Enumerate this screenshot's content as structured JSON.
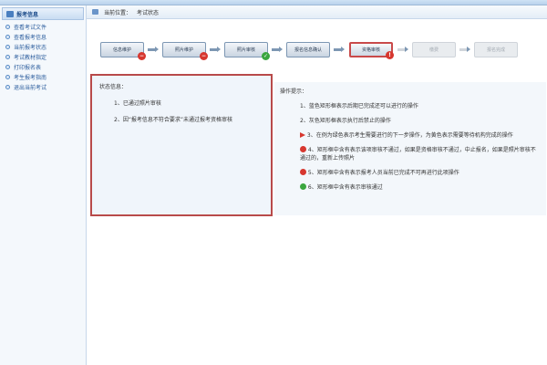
{
  "sidebar": {
    "header": "报考信息",
    "items": [
      {
        "label": "查看考试文件"
      },
      {
        "label": "查看报考信息"
      },
      {
        "label": "当前报考状态"
      },
      {
        "label": "考试教材指定"
      },
      {
        "label": "打印报名表"
      },
      {
        "label": "考生报考指南"
      },
      {
        "label": "退出当前考试"
      }
    ]
  },
  "breadcrumb": {
    "prefix": "当前位置：",
    "current": "考试状态"
  },
  "flow": {
    "steps": [
      {
        "label": "信息维护",
        "status": "error"
      },
      {
        "label": "照片维护",
        "status": "error"
      },
      {
        "label": "照片审核",
        "status": "ok"
      },
      {
        "label": "报名信息确认",
        "status": "none"
      },
      {
        "label": "资格审核",
        "status": "error"
      },
      {
        "label": "缴费",
        "status": "disabled"
      },
      {
        "label": "报名完成",
        "status": "disabled"
      }
    ]
  },
  "status": {
    "title": "状态信息：",
    "rows": [
      "1、已通过照片审核",
      "2、因“报考信息不符合要求”未通过报考资格审核"
    ]
  },
  "tips": {
    "title": "操作提示：",
    "items": [
      "1、蓝色矩形框表示后期已完成还可以进行的操作",
      "2、灰色矩形框表示执行后禁止的操作",
      "3、在例为绿色表示考生需要进行的下一步操作，为黄色表示需要等待机构完成的操作",
      "4、矩形框中含有表示该项审核不通过，如果是资格审核不通过，中止报名，如果是照片审核不通过的，重新上传照片",
      "5、矩形框中含有表示报考人员当前已完成不可再进行此项操作",
      "6、矩形框中含有表示审核通过"
    ]
  },
  "colors": {
    "accent": "#4a7fc0",
    "error": "#d7372f",
    "ok": "#3aa63e",
    "highlight": "#b84a4a"
  }
}
